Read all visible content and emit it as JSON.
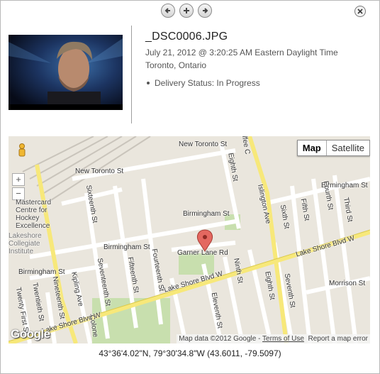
{
  "toolbar": {
    "prev_icon": "arrow-left-icon",
    "add_icon": "plus-icon",
    "next_icon": "arrow-right-icon",
    "close_icon": "close-icon"
  },
  "photo": {
    "filename": "_DSC0006.JPG",
    "datetime": "July 21, 2012 @ 3:20:25 AM Eastern Daylight Time",
    "location": "Toronto, Ontario",
    "status": "Delivery Status: In Progress"
  },
  "map": {
    "type_buttons": [
      "Map",
      "Satellite"
    ],
    "selected_type": "Map",
    "zoom_in": "+",
    "zoom_out": "−",
    "streets": {
      "new_toronto_st_1": "New Toronto St",
      "new_toronto_st_2": "New Toronto St",
      "birmingham_st_1": "Birmingham St",
      "birmingham_st_2": "Birmingham St",
      "birmingham_st_3": "Birmingham St",
      "birmingham_st_4": "Birmingham St",
      "garner_lane_rd": "Garner Lane Rd",
      "lake_shore_1": "Lake Shore Blvd W",
      "lake_shore_2": "Lake Shore Blvd W",
      "lake_shore_3": "Lake Shore Blvd W",
      "morrison_st": "Morrison St",
      "eighth_st_1": "Eighth St",
      "eighth_st_2": "Eighth St",
      "islington_ave": "Islington Ave",
      "sixth_st": "Sixth St",
      "fifth_st": "Fifth St",
      "fourth_st": "Fourth St",
      "third_st": "Third St",
      "seventh_st": "Seventh St",
      "ninth_st": "Ninth St",
      "eleventh_st": "Eleventh St",
      "sixteenth_st": "Sixteenth St",
      "fifteenth_st": "Fifteenth St",
      "fourteenth_st": "Fourteenth St",
      "seventeenth_st": "Seventeenth St",
      "nineteenth_st": "Nineteenth St",
      "twentieth_st": "Twentieth St",
      "twenty_first_st": "Twenty First St",
      "kipling_ave": "Kipling Ave",
      "colonel": "Colone",
      "coffee_c": "offee C"
    },
    "places": {
      "mastercard": "Mastercard Centre for Hockey Excellence",
      "lakeshore_ci": "Lakeshore Collegiate Institute"
    },
    "logo": "Google",
    "attribution": "Map data ©2012 Google",
    "terms": "Terms of Use",
    "report": "Report a map error",
    "colors": {
      "land": "#eae6dd",
      "road": "#ffffff",
      "arterial": "#f7e87a",
      "park": "#c8dfae",
      "rail": "#c9c4bb"
    }
  },
  "coordinates": "43°36'4.02\"N, 79°30'34.8\"W (43.6011, -79.5097)"
}
